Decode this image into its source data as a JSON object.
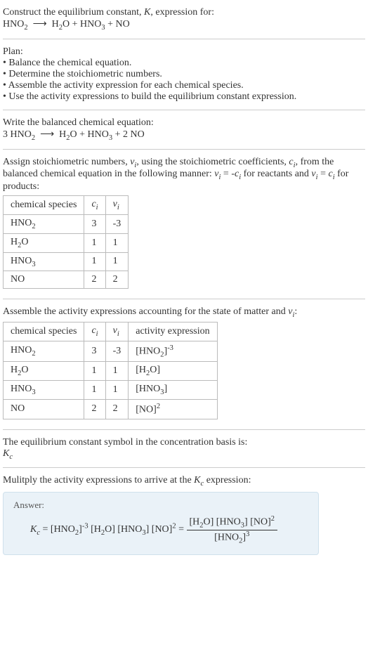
{
  "header": {
    "prompt": "Construct the equilibrium constant, K, expression for:",
    "equation": "HNO₂ ⟶ H₂O + HNO₃ + NO"
  },
  "plan": {
    "title": "Plan:",
    "items": [
      "• Balance the chemical equation.",
      "• Determine the stoichiometric numbers.",
      "• Assemble the activity expression for each chemical species.",
      "• Use the activity expressions to build the equilibrium constant expression."
    ]
  },
  "balanced": {
    "title": "Write the balanced chemical equation:",
    "equation": "3 HNO₂ ⟶ H₂O + HNO₃ + 2 NO"
  },
  "stoich": {
    "intro": "Assign stoichiometric numbers, νᵢ, using the stoichiometric coefficients, cᵢ, from the balanced chemical equation in the following manner: νᵢ = -cᵢ for reactants and νᵢ = cᵢ for products:",
    "headers": [
      "chemical species",
      "cᵢ",
      "νᵢ"
    ],
    "rows": [
      {
        "species": "HNO₂",
        "c": "3",
        "v": "-3"
      },
      {
        "species": "H₂O",
        "c": "1",
        "v": "1"
      },
      {
        "species": "HNO₃",
        "c": "1",
        "v": "1"
      },
      {
        "species": "NO",
        "c": "2",
        "v": "2"
      }
    ]
  },
  "activity": {
    "intro": "Assemble the activity expressions accounting for the state of matter and νᵢ:",
    "headers": [
      "chemical species",
      "cᵢ",
      "νᵢ",
      "activity expression"
    ],
    "rows": [
      {
        "species": "HNO₂",
        "c": "3",
        "v": "-3",
        "expr": "[HNO₂]⁻³"
      },
      {
        "species": "H₂O",
        "c": "1",
        "v": "1",
        "expr": "[H₂O]"
      },
      {
        "species": "HNO₃",
        "c": "1",
        "v": "1",
        "expr": "[HNO₃]"
      },
      {
        "species": "NO",
        "c": "2",
        "v": "2",
        "expr": "[NO]²"
      }
    ]
  },
  "basis": {
    "text": "The equilibrium constant symbol in the concentration basis is:",
    "symbol": "K𝒸"
  },
  "multiply": {
    "text": "Mulitply the activity expressions to arrive at the K𝒸 expression:"
  },
  "answer": {
    "label": "Answer:",
    "lhs": "K𝒸 = [HNO₂]⁻³ [H₂O] [HNO₃] [NO]² = ",
    "num": "[H₂O] [HNO₃] [NO]²",
    "den": "[HNO₂]³"
  }
}
